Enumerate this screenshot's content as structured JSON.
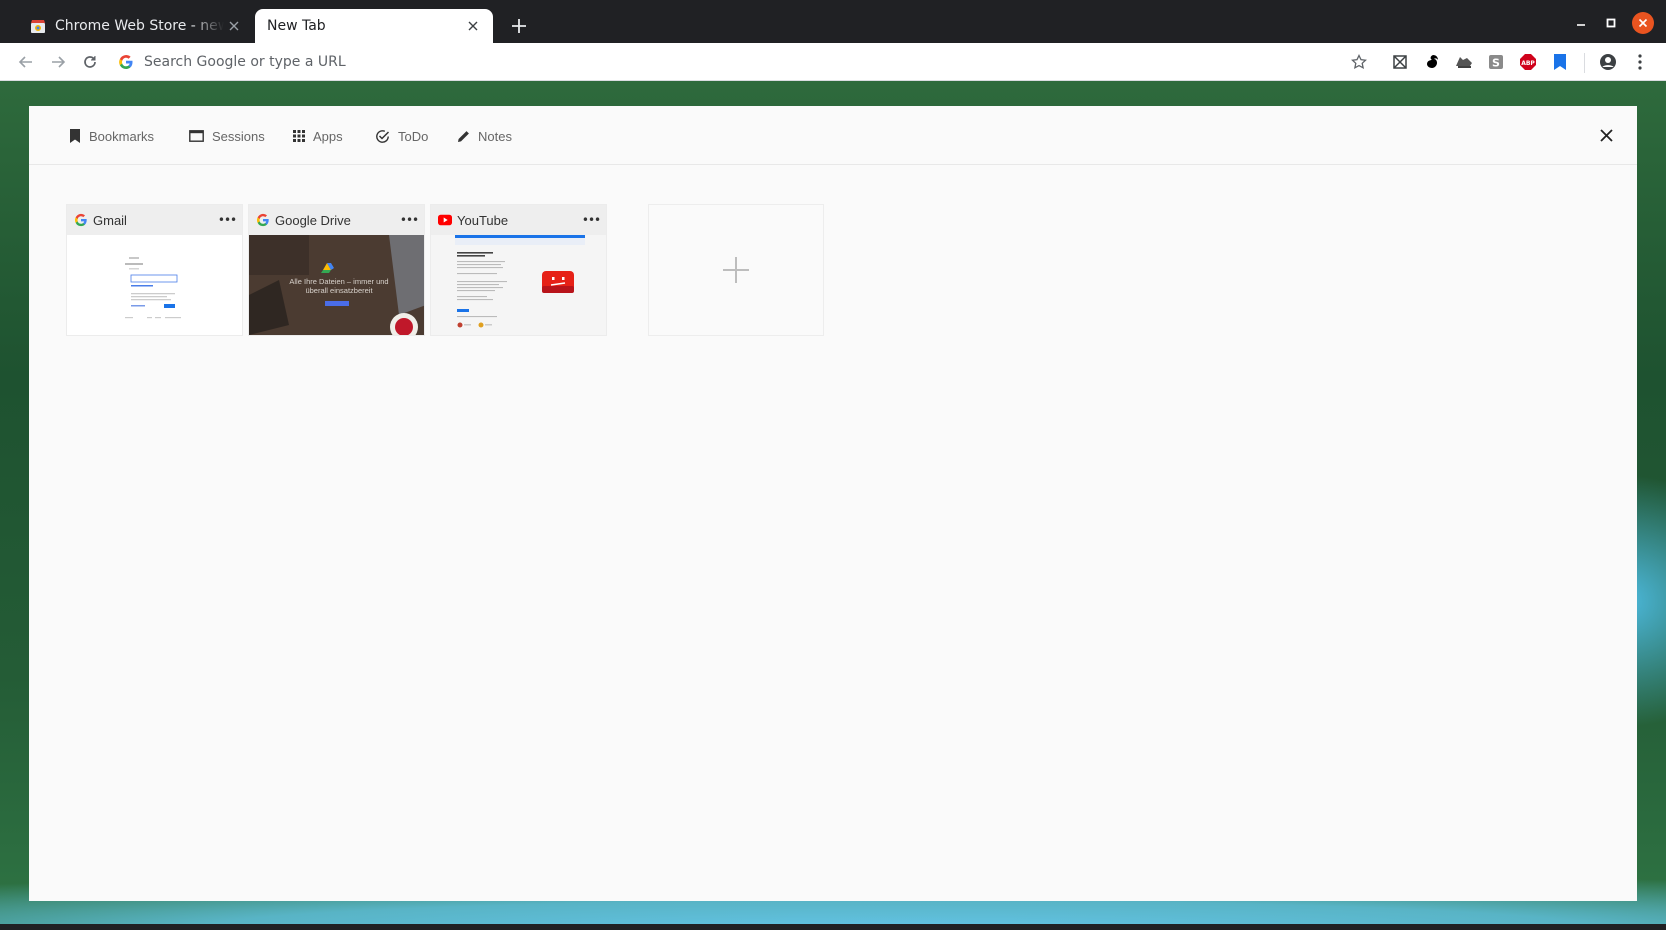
{
  "tabs": [
    {
      "title": "Chrome Web Store - new tab",
      "active": false,
      "favicon": "chrome-web-store-icon"
    },
    {
      "title": "New Tab",
      "active": true
    }
  ],
  "omnibox": {
    "placeholder": "Search Google or type a URL"
  },
  "extensions": [
    "puzzle-extension-icon",
    "gnome-extension-icon",
    "shoe-extension-icon",
    "s-extension-icon",
    "adblock-plus-icon",
    "bookmark-extension-icon"
  ],
  "panel": {
    "nav": [
      {
        "label": "Bookmarks",
        "icon": "bookmark-icon"
      },
      {
        "label": "Sessions",
        "icon": "window-icon"
      },
      {
        "label": "Apps",
        "icon": "apps-grid-icon"
      },
      {
        "label": "ToDo",
        "icon": "check-circle-icon"
      },
      {
        "label": "Notes",
        "icon": "pencil-icon"
      }
    ],
    "tiles": [
      {
        "title": "Gmail",
        "favicon": "google-icon"
      },
      {
        "title": "Google Drive",
        "favicon": "google-icon",
        "thumb_text": "Alle Ihre Dateien – immer und überall einsatzbereit"
      },
      {
        "title": "YouTube",
        "favicon": "youtube-icon"
      }
    ]
  },
  "colors": {
    "accent": "#e95420",
    "chrome_dark": "#202124",
    "panel_bg": "#fafafa"
  }
}
